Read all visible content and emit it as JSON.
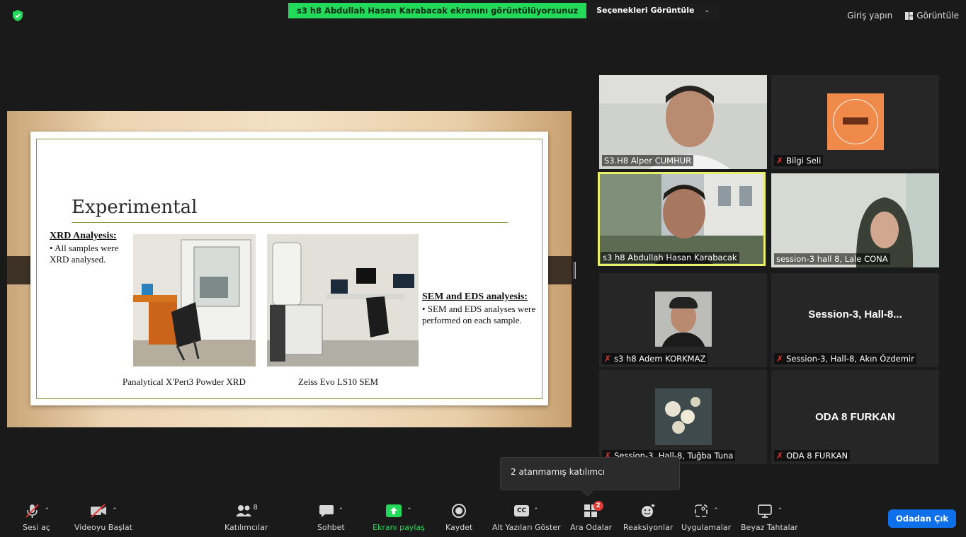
{
  "top": {
    "share_message": "s3 h8 Abdullah Hasan Karabacak ekranını görüntülüyorsunuz",
    "view_options": "Seçenekleri Görüntüle",
    "sign_in": "Giriş yapın",
    "view": "Görüntüle"
  },
  "slide": {
    "title": "Experimental",
    "xrd_heading": "XRD Analyesis:",
    "xrd_body": "•  All samples were XRD analysed.",
    "sem_heading": "SEM and EDS analyesis:",
    "sem_body": "•  SEM and EDS analyses were performed on each sample.",
    "caption1": "Panalytical X'Pert3 Powder XRD",
    "caption2": "Zeiss Evo LS10 SEM"
  },
  "participants": [
    {
      "name": "S3.H8 Alper CUMHUR",
      "muted": false
    },
    {
      "name": "Bilgi Seli",
      "muted": true
    },
    {
      "name": "s3 h8 Abdullah Hasan Karabacak",
      "muted": false
    },
    {
      "name": "session-3 hall 8, Lale CONA",
      "muted": false
    },
    {
      "name": "s3 h8 Adem KORKMAZ",
      "muted": true
    },
    {
      "name": "Session-3, Hall-8, Akın Özdemir",
      "muted": true,
      "display": "Session-3,  Hall-8..."
    },
    {
      "name": "Session-3, Hall-8, Tuğba Tuna",
      "muted": true
    },
    {
      "name": "ODA 8 FURKAN",
      "muted": true,
      "display": "ODA 8 FURKAN"
    }
  ],
  "tooltip": "2 atanmamış katılımcı",
  "toolbar": {
    "unmute": "Sesi aç",
    "start_video": "Videoyu Başlat",
    "participants": "Katılımcılar",
    "participants_count": "8",
    "chat": "Sohbet",
    "share_screen": "Ekranı paylaş",
    "record": "Kaydet",
    "captions": "Alt Yazıları Göster",
    "cc_badge": "CC",
    "breakout": "Ara Odalar",
    "breakout_badge": "2",
    "reactions": "Reaksiyonlar",
    "apps": "Uygulamalar",
    "whiteboards": "Beyaz Tahtalar",
    "leave_room": "Odadan Çık"
  },
  "colors": {
    "share_green": "#23d959",
    "active_speaker": "#e8f06b",
    "leave_blue": "#0e71eb",
    "mic_off_red": "#e53935"
  }
}
